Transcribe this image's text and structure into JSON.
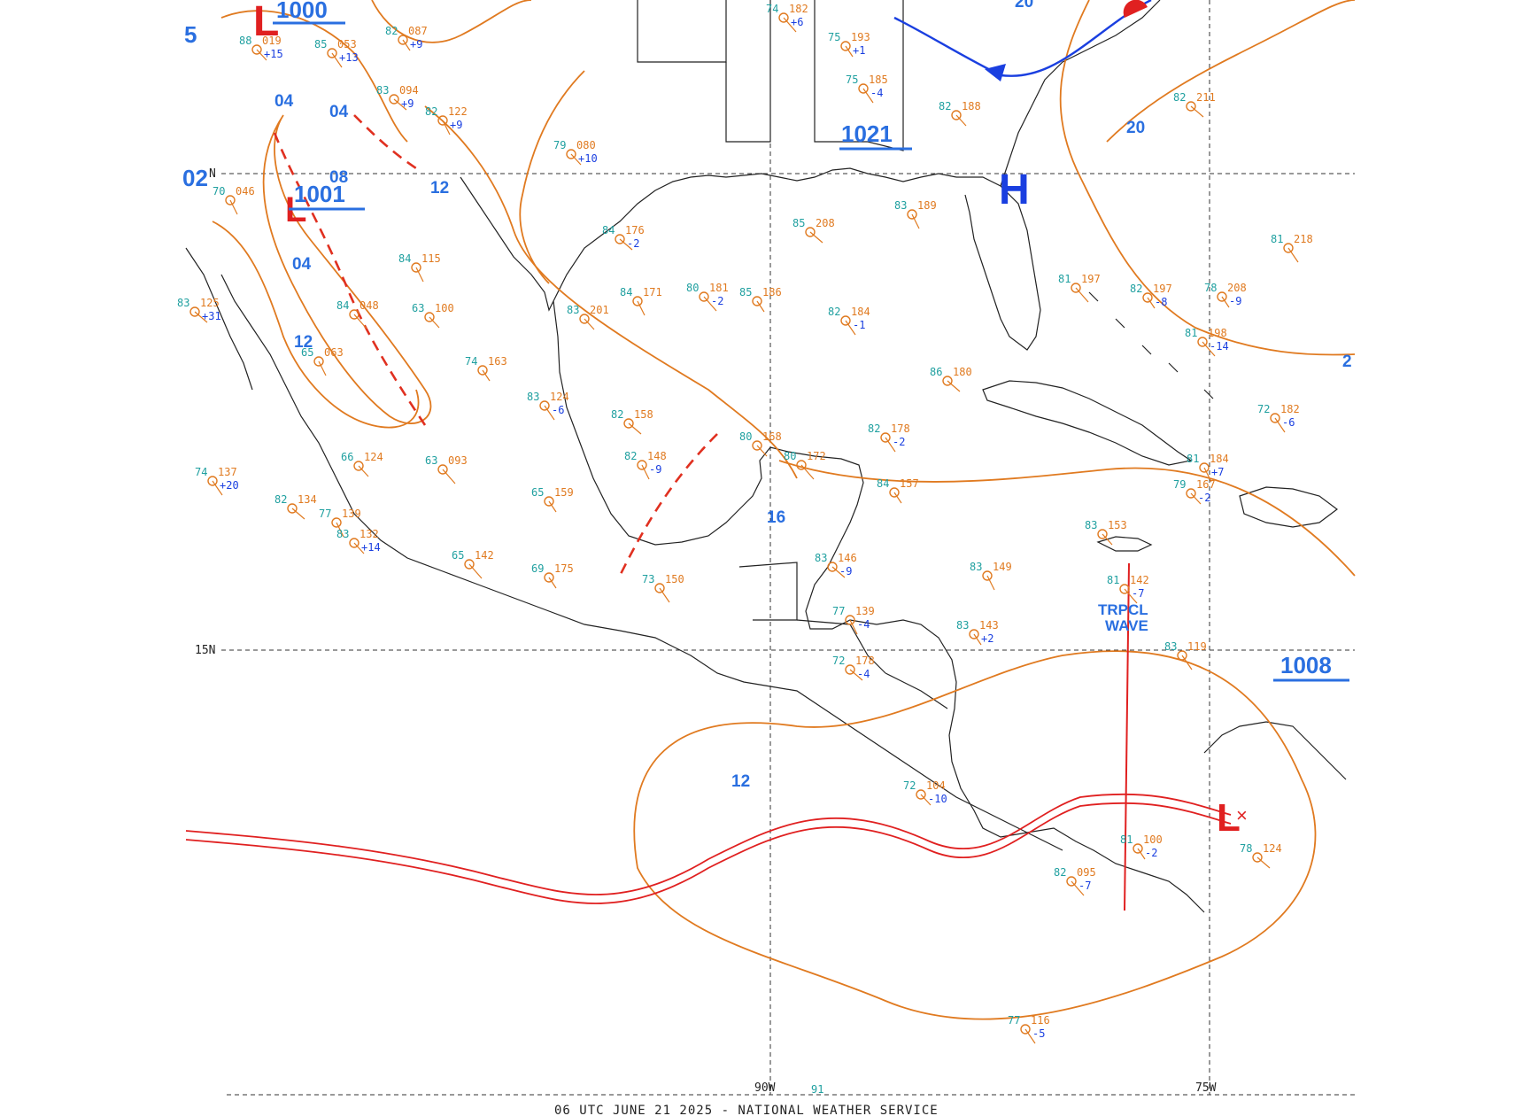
{
  "map": {
    "footer": "06 UTC JUNE 21 2025 - NATIONAL WEATHER SERVICE",
    "lat_labels": [
      "N",
      "15N"
    ],
    "lon_labels": [
      "90W",
      "75W",
      "91"
    ],
    "pressure_centers": [
      {
        "type": "H",
        "value": "1021"
      },
      {
        "type": "L",
        "value": "1000"
      },
      {
        "type": "L",
        "value": "1001"
      },
      {
        "type": "L",
        "value": "1008"
      }
    ],
    "isobar_labels": [
      "12",
      "12",
      "16",
      "20",
      "20",
      "08",
      "04",
      "04",
      "04",
      "12",
      "5",
      "2",
      "02"
    ],
    "tropical_wave": {
      "line1": "TRPCL",
      "line2": "WAVE"
    },
    "colors": {
      "isobar": "#e07a20",
      "front_cold": "#1a3fe0",
      "front_warm": "#e02020",
      "itcz": "#e02020",
      "label_blue": "#2a6fe0",
      "temp": "#e07a20",
      "dewpoint": "#d040d0",
      "cyan": "#20a0a0",
      "coast": "#222222"
    }
  },
  "stations": [
    {
      "t": "82",
      "p": "087",
      "c": "+9"
    },
    {
      "t": "85",
      "p": "053",
      "c": "+13"
    },
    {
      "t": "83",
      "p": "094",
      "c": "+9"
    },
    {
      "t": "82",
      "p": "122",
      "c": "+9"
    },
    {
      "t": "79",
      "p": "080",
      "c": "+10"
    },
    {
      "t": "74",
      "p": "182",
      "c": "+6"
    },
    {
      "t": "75",
      "p": "193",
      "c": "+1"
    },
    {
      "t": "75",
      "p": "185",
      "c": "-4"
    },
    {
      "t": "84",
      "p": "176",
      "c": "-2"
    },
    {
      "t": "84",
      "p": "171",
      "c": ""
    },
    {
      "t": "83",
      "p": "201",
      "c": ""
    },
    {
      "t": "80",
      "p": "181",
      "c": "-2"
    },
    {
      "t": "85",
      "p": "186",
      "c": ""
    },
    {
      "t": "82",
      "p": "184",
      "c": "-1"
    },
    {
      "t": "85",
      "p": "208",
      "c": ""
    },
    {
      "t": "83",
      "p": "189",
      "c": ""
    },
    {
      "t": "82",
      "p": "188",
      "c": ""
    },
    {
      "t": "81",
      "p": "197",
      "c": ""
    },
    {
      "t": "78",
      "p": "208",
      "c": "-9"
    },
    {
      "t": "81",
      "p": "218",
      "c": ""
    },
    {
      "t": "82",
      "p": "211",
      "c": ""
    },
    {
      "t": "84",
      "p": "115",
      "c": ""
    },
    {
      "t": "63",
      "p": "100",
      "c": ""
    },
    {
      "t": "84",
      "p": "048",
      "c": ""
    },
    {
      "t": "74",
      "p": "163",
      "c": ""
    },
    {
      "t": "83",
      "p": "124",
      "c": "-6"
    },
    {
      "t": "82",
      "p": "158",
      "c": ""
    },
    {
      "t": "82",
      "p": "148",
      "c": "-9"
    },
    {
      "t": "80",
      "p": "168",
      "c": ""
    },
    {
      "t": "80",
      "p": "172",
      "c": ""
    },
    {
      "t": "84",
      "p": "157",
      "c": ""
    },
    {
      "t": "82",
      "p": "178",
      "c": "-2"
    },
    {
      "t": "86",
      "p": "180",
      "c": ""
    },
    {
      "t": "65",
      "p": "063",
      "c": ""
    },
    {
      "t": "66",
      "p": "124",
      "c": ""
    },
    {
      "t": "63",
      "p": "093",
      "c": ""
    },
    {
      "t": "65",
      "p": "159",
      "c": ""
    },
    {
      "t": "74",
      "p": "137",
      "c": "+20"
    },
    {
      "t": "82",
      "p": "134",
      "c": ""
    },
    {
      "t": "77",
      "p": "139",
      "c": ""
    },
    {
      "t": "83",
      "p": "132",
      "c": "+14"
    },
    {
      "t": "65",
      "p": "142",
      "c": ""
    },
    {
      "t": "69",
      "p": "175",
      "c": ""
    },
    {
      "t": "73",
      "p": "150",
      "c": ""
    },
    {
      "t": "83",
      "p": "146",
      "c": "-9"
    },
    {
      "t": "83",
      "p": "149",
      "c": ""
    },
    {
      "t": "83",
      "p": "153",
      "c": ""
    },
    {
      "t": "81",
      "p": "142",
      "c": "-7"
    },
    {
      "t": "83",
      "p": "143",
      "c": "+2"
    },
    {
      "t": "83",
      "p": "119",
      "c": ""
    },
    {
      "t": "72",
      "p": "178",
      "c": "-4"
    },
    {
      "t": "77",
      "p": "139",
      "c": "-4"
    },
    {
      "t": "72",
      "p": "104",
      "c": "-10"
    },
    {
      "t": "82",
      "p": "095",
      "c": "-7"
    },
    {
      "t": "81",
      "p": "100",
      "c": "-2"
    },
    {
      "t": "77",
      "p": "116",
      "c": "-5"
    },
    {
      "t": "78",
      "p": "124",
      "c": ""
    },
    {
      "t": "81",
      "p": "184",
      "c": "+7"
    },
    {
      "t": "79",
      "p": "167",
      "c": "-2"
    },
    {
      "t": "81",
      "p": "198",
      "c": "-14"
    },
    {
      "t": "82",
      "p": "197",
      "c": "-8"
    },
    {
      "t": "72",
      "p": "182",
      "c": "-6"
    },
    {
      "t": "83",
      "p": "125",
      "c": "+31"
    },
    {
      "t": "70",
      "p": "046",
      "c": ""
    },
    {
      "t": "88",
      "p": "019",
      "c": "+15"
    }
  ]
}
